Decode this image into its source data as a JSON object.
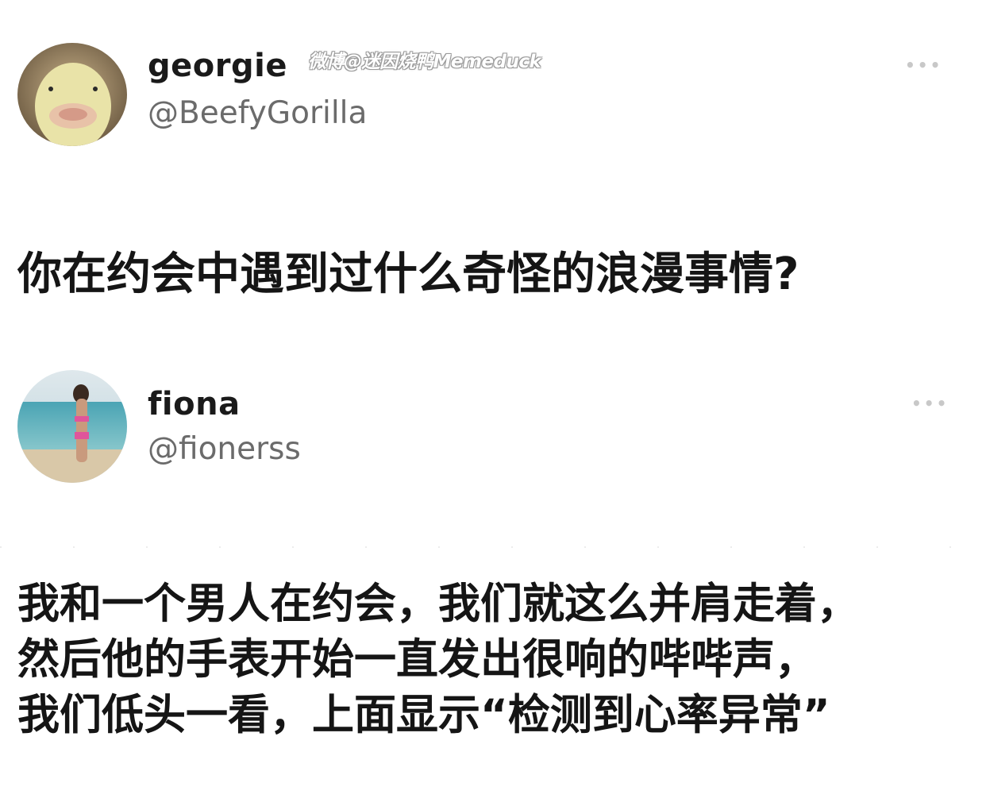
{
  "post1": {
    "display_name": "georgie",
    "handle": "@BeefyGorilla",
    "watermark": "微博@迷因烧鸭Memeduck",
    "avatar_icon": "duck-avatar",
    "more_icon": "more-options-icon",
    "more_label": "•••",
    "text": "你在约会中遇到过什么奇怪的浪漫事情?"
  },
  "post2": {
    "display_name": "fiona",
    "handle": "@fionerss",
    "avatar_icon": "beach-photo-avatar",
    "more_icon": "more-options-icon",
    "more_label": "•••",
    "text_lines": [
      "我和一个男人在约会，我们就这么并肩走着，",
      "然后他的手表开始一直发出很响的哔哔声，",
      "我们低头一看，上面显示“检测到心率异常”"
    ]
  },
  "colors": {
    "background": "#ffffff",
    "text": "#151515",
    "handle": "#6b6b6b",
    "more": "#c8c8c8"
  }
}
